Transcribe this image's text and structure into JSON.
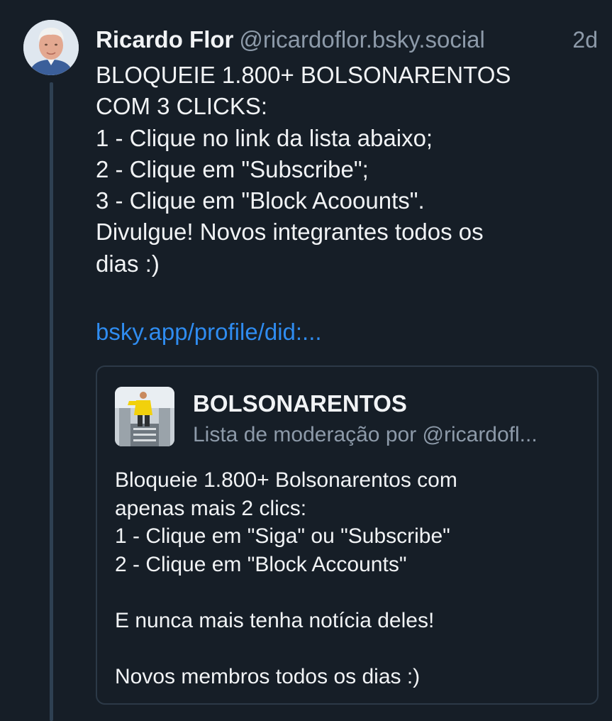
{
  "post": {
    "author_name": "Ricardo Flor",
    "author_handle": "@ricardoflor.bsky.social",
    "time": "2d",
    "text_lines": [
      "BLOQUEIE 1.800+ BOLSONARENTOS",
      "COM 3 CLICKS:",
      "1 - Clique no link da lista abaixo;",
      "2 - Clique em \"Subscribe\";",
      "3 - Clique em \"Block Acoounts\".",
      "Divulgue! Novos integrantes todos os",
      "dias :)"
    ],
    "link_text": "bsky.app/profile/did:..."
  },
  "embed": {
    "title": "BOLSONARENTOS",
    "subtitle": "Lista de moderação por @ricardofl...",
    "description_lines": [
      "Bloqueie 1.800+ Bolsonarentos com",
      "apenas mais 2 clics:",
      "1 - Clique em \"Siga\" ou \"Subscribe\"",
      "2 - Clique em \"Block Accounts\"",
      "",
      "E nunca mais tenha notícia deles!",
      "",
      "Novos membros todos os dias :)"
    ]
  },
  "colors": {
    "background": "#161e27",
    "text": "#f1f3f5",
    "muted": "#8d9aa9",
    "link": "#2f8cf0",
    "border": "#2c3947",
    "thread_line": "#2e4052"
  }
}
